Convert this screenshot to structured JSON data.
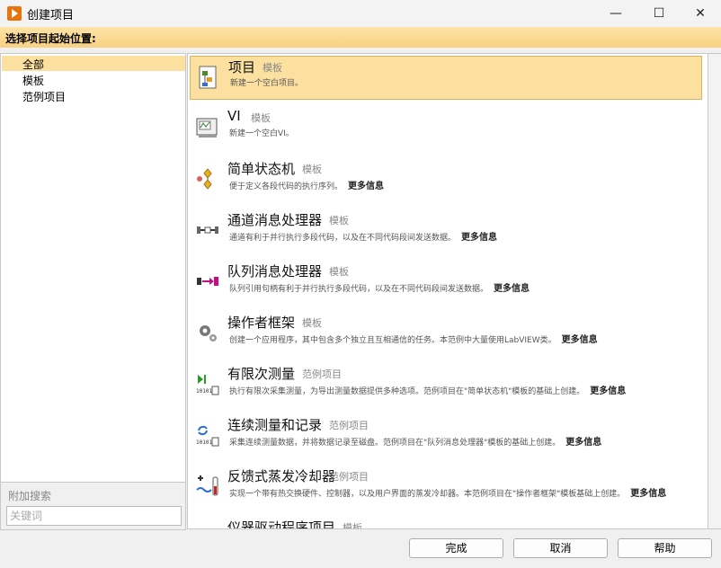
{
  "window": {
    "title": "创建项目",
    "minimize": "—",
    "maximize": "☐",
    "close": "✕"
  },
  "instruction": "选择项目起始位置:",
  "categories": [
    {
      "label": "全部",
      "selected": true
    },
    {
      "label": "模板",
      "selected": false
    },
    {
      "label": "范例项目",
      "selected": false
    }
  ],
  "search": {
    "label": "附加搜索",
    "placeholder": "关键词",
    "value": ""
  },
  "items": [
    {
      "title": "项目",
      "kind": "模板",
      "desc": "新建一个空白项目。",
      "more": "",
      "icon": "project-icon",
      "selected": true
    },
    {
      "title": "VI",
      "kind": "模板",
      "desc": "新建一个空白VI。",
      "more": "",
      "icon": "vi-icon",
      "selected": false
    },
    {
      "title": "简单状态机",
      "kind": "模板",
      "desc": "便于定义各段代码的执行序列。",
      "more": "更多信息",
      "icon": "state-machine-icon",
      "selected": false
    },
    {
      "title": "通道消息处理器",
      "kind": "模板",
      "desc": "通道有利于并行执行多段代码，以及在不同代码段间发送数据。",
      "more": "更多信息",
      "icon": "channel-icon",
      "selected": false
    },
    {
      "title": "队列消息处理器",
      "kind": "模板",
      "desc": "队列引用句柄有利于并行执行多段代码，以及在不同代码段间发送数据。",
      "more": "更多信息",
      "icon": "queue-icon",
      "selected": false
    },
    {
      "title": "操作者框架",
      "kind": "模板",
      "desc": "创建一个应用程序，其中包含多个独立且互相通信的任务。本范例中大量使用LabVIEW类。",
      "more": "更多信息",
      "icon": "gear-icon",
      "selected": false
    },
    {
      "title": "有限次测量",
      "kind": "范例项目",
      "desc": "执行有限次采集测量，为导出测量数据提供多种选项。范例项目在\"简单状态机\"模板的基础上创建。",
      "more": "更多信息",
      "icon": "finite-measure-icon",
      "selected": false
    },
    {
      "title": "连续测量和记录",
      "kind": "范例项目",
      "desc": "采集连续测量数据，并将数据记录至磁盘。范例项目在\"队列消息处理器\"模板的基础上创建。",
      "more": "更多信息",
      "icon": "continuous-log-icon",
      "selected": false
    },
    {
      "title": "反馈式蒸发冷却器",
      "kind": "范例项目",
      "desc": "实现一个带有热交换硬件、控制器，以及用户界面的蒸发冷却器。本范例项目在\"操作者框架\"模板基础上创建。",
      "more": "更多信息",
      "icon": "cooler-icon",
      "selected": false
    },
    {
      "title": "仪器驱动程序项目",
      "kind": "模板",
      "desc": "",
      "more": "",
      "icon": "instrument-icon",
      "selected": false
    }
  ],
  "buttons": {
    "finish": "完成",
    "cancel": "取消",
    "help": "帮助"
  }
}
